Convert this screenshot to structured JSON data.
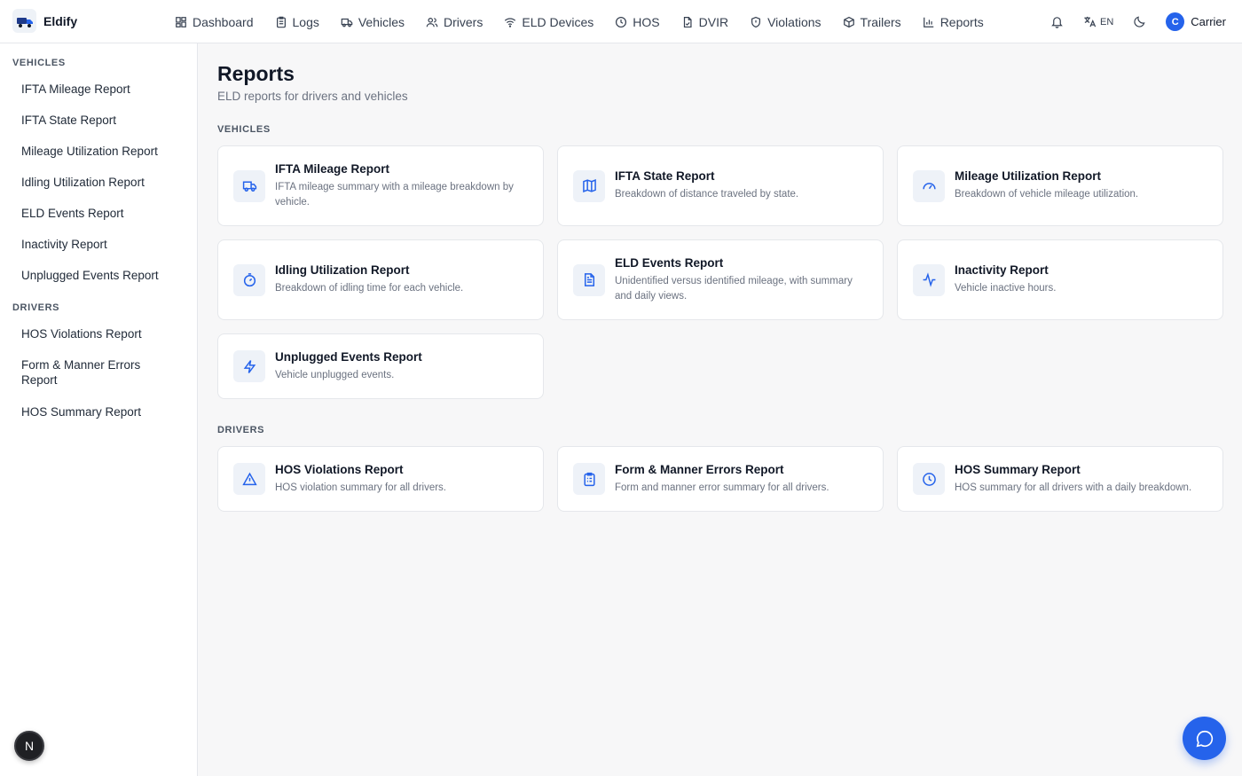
{
  "brand": {
    "name": "Eldify"
  },
  "nav": [
    {
      "label": "Dashboard",
      "icon": "dashboard-icon"
    },
    {
      "label": "Logs",
      "icon": "logs-icon"
    },
    {
      "label": "Vehicles",
      "icon": "truck-icon"
    },
    {
      "label": "Drivers",
      "icon": "users-icon"
    },
    {
      "label": "ELD Devices",
      "icon": "wifi-icon"
    },
    {
      "label": "HOS",
      "icon": "clock-icon"
    },
    {
      "label": "DVIR",
      "icon": "file-check-icon"
    },
    {
      "label": "Violations",
      "icon": "shield-icon"
    },
    {
      "label": "Trailers",
      "icon": "box-icon"
    },
    {
      "label": "Reports",
      "icon": "bar-chart-icon"
    }
  ],
  "topbar": {
    "language": "EN",
    "user_initial": "C",
    "user_name": "Carrier"
  },
  "sidebar": {
    "sections": [
      {
        "label": "VEHICLES",
        "items": [
          {
            "label": "IFTA Mileage Report"
          },
          {
            "label": "IFTA State Report"
          },
          {
            "label": "Mileage Utilization Report"
          },
          {
            "label": "Idling Utilization Report"
          },
          {
            "label": "ELD Events Report"
          },
          {
            "label": "Inactivity Report"
          },
          {
            "label": "Unplugged Events Report"
          }
        ]
      },
      {
        "label": "DRIVERS",
        "items": [
          {
            "label": "HOS Violations Report"
          },
          {
            "label": "Form & Manner Errors Report"
          },
          {
            "label": "HOS Summary Report"
          }
        ]
      }
    ],
    "help_label": "N"
  },
  "page": {
    "title": "Reports",
    "subtitle": "ELD reports for drivers and vehicles"
  },
  "sections": [
    {
      "label": "VEHICLES",
      "cards": [
        {
          "title": "IFTA Mileage Report",
          "desc": "IFTA mileage summary with a mileage breakdown by vehicle.",
          "icon": "truck-icon"
        },
        {
          "title": "IFTA State Report",
          "desc": "Breakdown of distance traveled by state.",
          "icon": "map-icon"
        },
        {
          "title": "Mileage Utilization Report",
          "desc": "Breakdown of vehicle mileage utilization.",
          "icon": "gauge-icon"
        },
        {
          "title": "Idling Utilization Report",
          "desc": "Breakdown of idling time for each vehicle.",
          "icon": "timer-icon"
        },
        {
          "title": "ELD Events Report",
          "desc": "Unidentified versus identified mileage, with summary and daily views.",
          "icon": "document-icon"
        },
        {
          "title": "Inactivity Report",
          "desc": "Vehicle inactive hours.",
          "icon": "activity-icon"
        },
        {
          "title": "Unplugged Events Report",
          "desc": "Vehicle unplugged events.",
          "icon": "zap-icon"
        }
      ]
    },
    {
      "label": "DRIVERS",
      "cards": [
        {
          "title": "HOS Violations Report",
          "desc": "HOS violation summary for all drivers.",
          "icon": "warning-icon"
        },
        {
          "title": "Form & Manner Errors Report",
          "desc": "Form and manner error summary for all drivers.",
          "icon": "clipboard-icon"
        },
        {
          "title": "HOS Summary Report",
          "desc": "HOS summary for all drivers with a daily breakdown.",
          "icon": "clock-icon"
        }
      ]
    }
  ],
  "colors": {
    "accent": "#2563eb",
    "icon_bg": "#eef2f8",
    "text": "#111827",
    "muted": "#6b7280"
  }
}
